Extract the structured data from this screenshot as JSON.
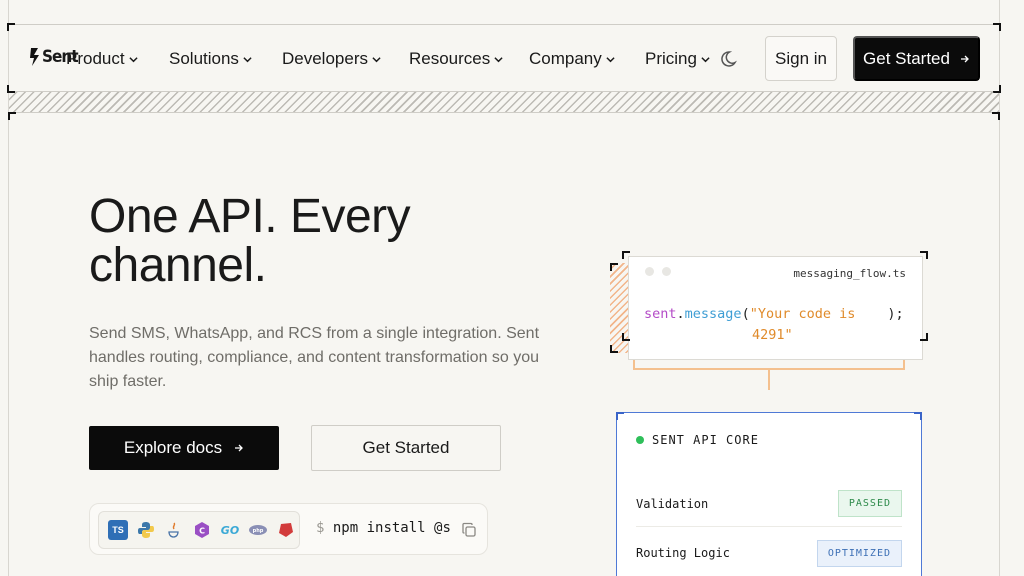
{
  "brand": {
    "logo_text": "Sent"
  },
  "nav": {
    "items": [
      {
        "label": "Product"
      },
      {
        "label": "Solutions"
      },
      {
        "label": "Developers"
      },
      {
        "label": "Resources"
      },
      {
        "label": "Company"
      },
      {
        "label": "Pricing"
      }
    ],
    "sign_in": "Sign in",
    "get_started": "Get Started"
  },
  "hero": {
    "headline": "One API. Every channel.",
    "subtext": "Send SMS, WhatsApp, and RCS from a single integration. Sent handles routing, compliance, and content transformation so you ship faster.",
    "primary_cta": "Explore docs",
    "secondary_cta": "Get Started",
    "install_prompt": "$",
    "install_command": "npm install @s"
  },
  "languages": [
    "TS",
    "Python",
    "Java",
    "C#",
    "Go",
    "PHP",
    "Ruby"
  ],
  "code_card": {
    "filename": "messaging_flow.ts",
    "object": "sent",
    "dot": ".",
    "method": "message",
    "open_paren": "(",
    "string_line1": "\"Your code is",
    "string_line2": "4291\"",
    "close": ");"
  },
  "api_card": {
    "title": "SENT API CORE",
    "rows": [
      {
        "label": "Validation",
        "status": "PASSED"
      },
      {
        "label": "Routing Logic",
        "status": "OPTIMIZED"
      }
    ]
  },
  "colors": {
    "background": "#f7f6f2",
    "primary_button": "#0b0b0b",
    "accent_orange": "#f4c08e",
    "accent_blue": "#4f79d6",
    "status_green": "#2fbf5a"
  }
}
